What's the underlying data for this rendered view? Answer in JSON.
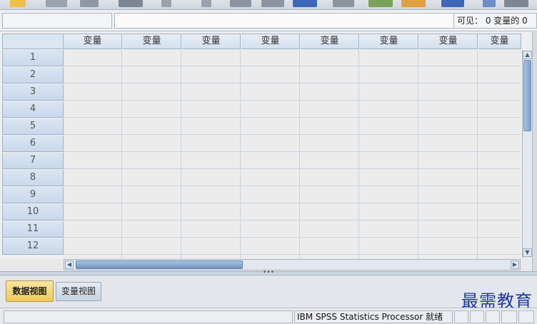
{
  "editbar": {
    "cell_name": "",
    "cell_value": "",
    "visible_label": "可见： 0 变量的 0"
  },
  "grid": {
    "column_headers": [
      "变量",
      "变量",
      "变量",
      "变量",
      "变量",
      "变量",
      "变量",
      "变量"
    ],
    "row_headers": [
      "1",
      "2",
      "3",
      "4",
      "5",
      "6",
      "7",
      "8",
      "9",
      "10",
      "11",
      "12"
    ]
  },
  "tabs": {
    "data_view": "数据视图",
    "variable_view": "变量视图"
  },
  "status": {
    "processor": "IBM SPSS Statistics Processor 就绪"
  },
  "watermark": "最需教育",
  "colors": {
    "active_tab": "#f0c95a",
    "header_blue": "#d4e0ee",
    "watermark": "#1f36a8"
  },
  "icons": {
    "vscroll_up": "▲",
    "vscroll_down": "▼",
    "hscroll_left": "◀",
    "hscroll_right": "▶",
    "splitter_grip": "•••"
  }
}
